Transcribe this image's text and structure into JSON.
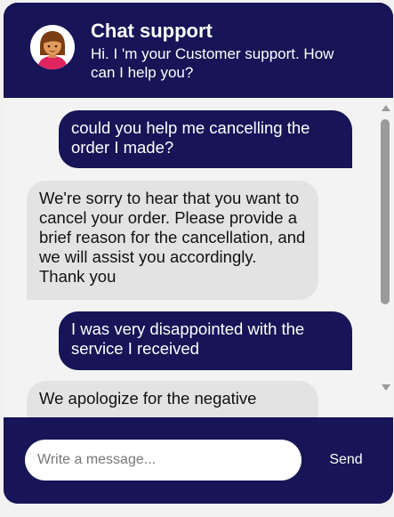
{
  "header": {
    "title": "Chat support",
    "subtitle": "Hi. I 'm your Customer support. How can I help you?",
    "avatar_icon": "support-agent-avatar-icon"
  },
  "messages": [
    {
      "sender": "user",
      "text": "could you help me cancelling the order I made?"
    },
    {
      "sender": "bot",
      "text": "We're sorry to hear that you want to cancel your order. Please provide a brief reason for the cancellation, and we will assist you accordingly. Thank you"
    },
    {
      "sender": "user",
      "text": "I was very disappointed with the service I received"
    },
    {
      "sender": "bot",
      "text": "We apologize for the negative"
    }
  ],
  "composer": {
    "placeholder": "Write a message...",
    "value": "",
    "send_label": "Send"
  },
  "colors": {
    "brand": "#171457",
    "user_bubble": "#171457",
    "bot_bubble": "#e3e3e3",
    "chat_background": "#f3f3f3"
  }
}
